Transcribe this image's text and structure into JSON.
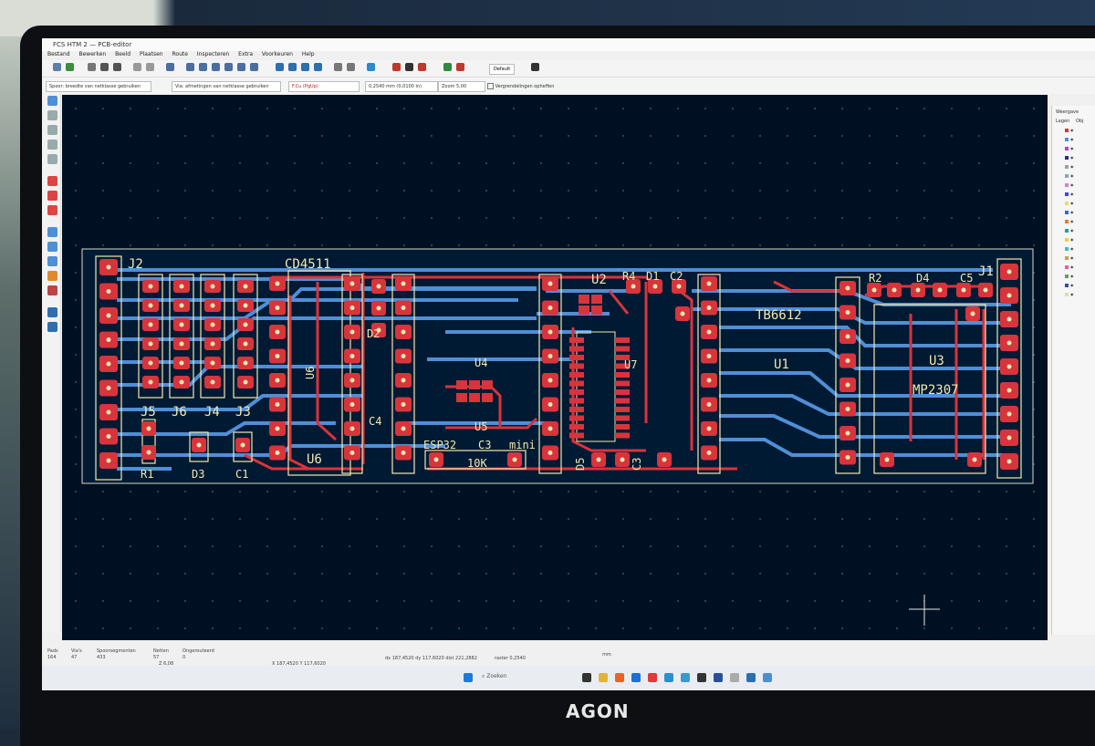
{
  "window": {
    "title": "FCS HTM 2 — PCB-editor"
  },
  "menu": [
    "Bestand",
    "Bewerken",
    "Beeld",
    "Plaatsen",
    "Route",
    "Inspecteren",
    "Extra",
    "Voorkeuren",
    "Help"
  ],
  "options": {
    "track": "Spoor: breedte van netklasse gebruiken",
    "via": "Via: afmetingen van netklasse gebruiken",
    "layer": "F.Cu (PgUp)",
    "grid": "0,2540 mm (0,0100 in)",
    "zoom": "Zoom 5,00",
    "constraint": "Vergrendelingen opheffen",
    "profile": "Default"
  },
  "right_panel": {
    "tab": "Weergave",
    "header_layers": "Lagen",
    "header_objects": "Obj"
  },
  "pcb_labels": {
    "cd4511": "CD4511",
    "j2": "J2",
    "u2": "U2",
    "r4": "R4",
    "d1": "D1",
    "c2": "C2",
    "r2": "R2",
    "d4": "D4",
    "c5": "C5",
    "j1": "J1",
    "d2": "D2",
    "tb6612": "TB6612",
    "u1": "U1",
    "u4": "U4",
    "u7": "U7",
    "u3": "U3",
    "mp2307": "MP2307",
    "j5": "J5",
    "j6": "J6",
    "j4": "J4",
    "j3": "J3",
    "c4": "C4",
    "u5": "U5",
    "u6": "U6",
    "u6v": "U6",
    "esp32": "ESP32",
    "c3": "C3",
    "mini": "mini",
    "tenk": "10K",
    "r1": "R1",
    "d3": "D3",
    "c1": "C1",
    "d5": "D5",
    "c3b": "C3"
  },
  "status": {
    "pads_label": "Pads",
    "pads": "164",
    "vias_label": "Via's",
    "vias": "47",
    "segments_label": "Spoorsegmenten",
    "segments": "433",
    "nets_label": "Netten",
    "nets": "57",
    "unrouted_label": "Ongerouteerd",
    "unrouted": "0",
    "zoom": "Z 6,08",
    "xy": "X 187,4520  Y 117,6020",
    "dxy": "dx 187,4520  dy 117,6020  dist 221,2882",
    "grid": "raster 0,2540",
    "unit": "mm"
  },
  "taskbar": {
    "search": "Zoeken"
  },
  "monitor_brand": "AGON",
  "colors": {
    "front_copper": "#d8343c",
    "back_copper": "#4f8fd6",
    "silkscreen": "#f2e8b0",
    "canvas": "#001023"
  }
}
